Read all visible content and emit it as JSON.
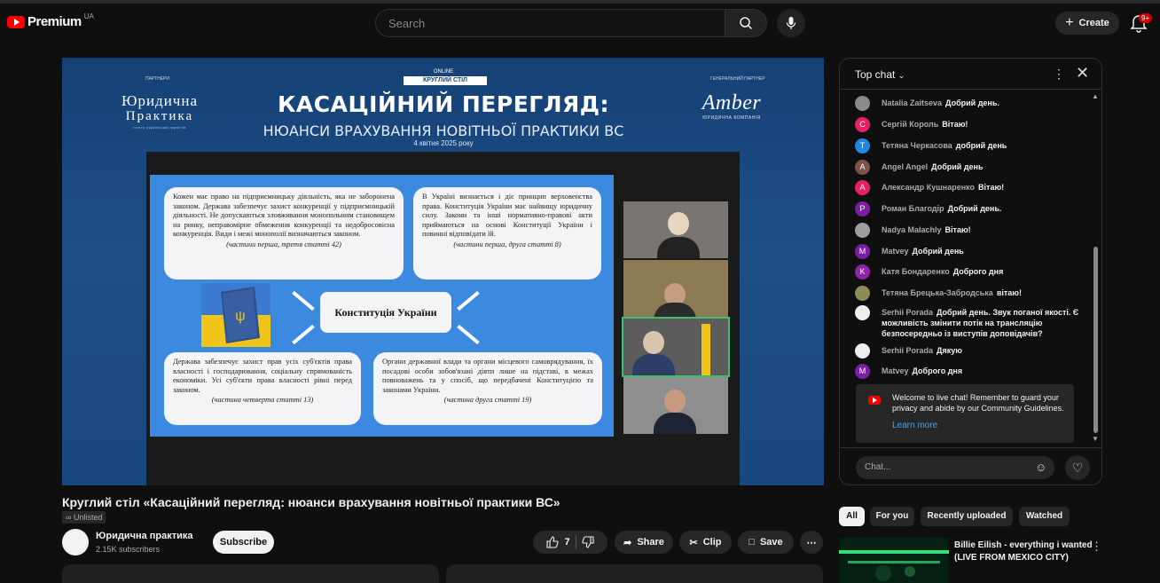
{
  "header": {
    "logo_text": "Premium",
    "region": "UA",
    "search_placeholder": "Search",
    "create_label": "Create",
    "notification_count": "9+"
  },
  "video": {
    "small_left": "ПАРТНЕРИ",
    "small_right": "ГЕНЕРАЛЬНИЙ ПАРТНЕР",
    "org_left_line1": "Юридична",
    "org_left_line2": "Практика",
    "org_left_tagline": "газета українських юристів",
    "online": "ONLINE",
    "round_table": "КРУГЛИЙ СТІЛ",
    "main_title": "КАСАЦІЙНИЙ ПЕРЕГЛЯД:",
    "sub_title": "НЮАНСИ ВРАХУВАННЯ НОВІТНЬОЇ ПРАКТИКИ ВС",
    "date": "4 квітня 2025 року",
    "org_right_name": "Amber",
    "org_right_sub": "ЮРИДИЧНА КОМПАНІЯ",
    "slide": {
      "card1_text": "Кожен має право на підприємницьку діяльність, яка не заборонена законом. Держава забезпечує захист конкуренції у підприємницькій діяльності. Не допускаються зловживання монопольним становищем на ринку, неправомірне обмеження конкуренції та недобросовісна конкуренція. Види і межі монополії визначаються законом.",
      "card1_cite": "(частини перша, третя статті 42)",
      "card2_text": "В Україні визнається і діє принцип верховенства права. Конституція України має найвищу юридичну силу. Закони та інші нормативно-правові акти приймаються на основі Конституції України і повинні відповідати їй.",
      "card2_cite": "(частини перша, друга статті 8)",
      "center": "Конституція України",
      "card3_text": "Держава забезпечує захист прав усіх суб'єктів права власності і господарювання, соціальну спрямованість економіки. Усі суб'єкти права власності рівні перед законом.",
      "card3_cite": "(частина четверта статті 13)",
      "card4_text": "Органи державної влади та органи місцевого самоврядування, їх посадові особи зобов'язані діяти лише на підставі, в межах повноважень та у спосіб, що передбачені Конституцією та законами України.",
      "card4_cite": "(частина друга статті 19)"
    }
  },
  "chat": {
    "title": "Top chat",
    "messages": [
      {
        "author": "Natalia Zaitseva",
        "text": "Добрий день.",
        "initial": "",
        "color": "#8a8a8a"
      },
      {
        "author": "Сергій Король",
        "text": "Вітаю!",
        "initial": "C",
        "color": "#e91e63"
      },
      {
        "author": "Тетяна Черкасова",
        "text": "добрий день",
        "initial": "T",
        "color": "#1e88e5"
      },
      {
        "author": "Angel Angel",
        "text": "Добрий день",
        "initial": "A",
        "color": "#795548"
      },
      {
        "author": "Александр Кушнаренко",
        "text": "Вітаю!",
        "initial": "A",
        "color": "#e91e63"
      },
      {
        "author": "Роман Благодір",
        "text": "Добрий день.",
        "initial": "P",
        "color": "#7b1fa2"
      },
      {
        "author": "Nadya Malachly",
        "text": "Вітаю!",
        "initial": "",
        "color": "#9e9e9e"
      },
      {
        "author": "Matvey",
        "text": "Добрий день",
        "initial": "M",
        "color": "#7b1fa2"
      },
      {
        "author": "Катя Бондаренко",
        "text": "Доброго дня",
        "initial": "K",
        "color": "#8e24aa"
      },
      {
        "author": "Тетяна Брецька-Забродська",
        "text": "вітаю!",
        "initial": "",
        "color": "#8d8d5a"
      },
      {
        "author": "Serhii Porada",
        "text": "Добрий день. Звук поганої якості. Є можливість змінити потік на трансляцію безпосередньо із виступів доповідачів?",
        "initial": "",
        "color": "#eeeeee"
      },
      {
        "author": "Serhii Porada",
        "text": "Дякую",
        "initial": "",
        "color": "#eeeeee"
      },
      {
        "author": "Matvey",
        "text": "Доброго дня",
        "initial": "M",
        "color": "#7b1fa2"
      }
    ],
    "welcome_text": "Welcome to live chat! Remember to guard your privacy and abide by our Community Guidelines.",
    "learn_more": "Learn more",
    "input_placeholder": "Chat..."
  },
  "below": {
    "title": "Круглий стіл «Касаційний перегляд: нюанси врахування новітньої практики ВС»",
    "visibility": "Unlisted",
    "channel_name": "Юридична практика",
    "subscribers": "2.15K subscribers",
    "subscribe_label": "Subscribe",
    "likes": "7",
    "share_label": "Share",
    "clip_label": "Clip",
    "save_label": "Save"
  },
  "sidebar": {
    "chips": [
      "All",
      "For you",
      "Recently uploaded",
      "Watched"
    ],
    "rec_title": "Billie Eilish - everything i wanted (LIVE FROM MEXICO CITY)"
  }
}
